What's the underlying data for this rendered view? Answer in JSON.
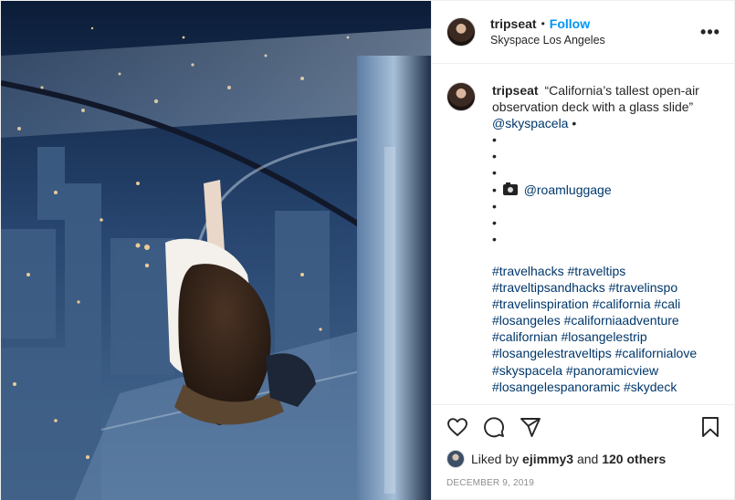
{
  "post": {
    "username": "tripseat",
    "separator": "•",
    "follow_label": "Follow",
    "location": "Skyspace Los Angeles",
    "more_label": "•••"
  },
  "caption": {
    "username": "tripseat",
    "text": "“California’s tallest open-air observation deck with a glass slide”",
    "mention": "@skyspacela",
    "bullet": "•",
    "photo_credit": "@roamluggage",
    "hashtags": "#travelhacks #traveltips #traveltipsandhacks #travelinspo #travelinspiration #california #cali #losangeles #californiaadventure #californian #losangelestrip #losangelestraveltips #californialove #skyspacela #panoramicview #losangelespanoramic #skydeck"
  },
  "likes": {
    "prefix": "Liked by",
    "user": "ejimmy3",
    "middle": "and",
    "others": "120 others"
  },
  "date": "December 9, 2019",
  "icons": {
    "like": "heart-icon",
    "comment": "comment-icon",
    "share": "paper-plane-icon",
    "save": "bookmark-icon",
    "photo_credit": "camera-icon"
  },
  "colors": {
    "link": "#00376b",
    "follow": "#0095f6",
    "muted": "#8e8e8e"
  }
}
